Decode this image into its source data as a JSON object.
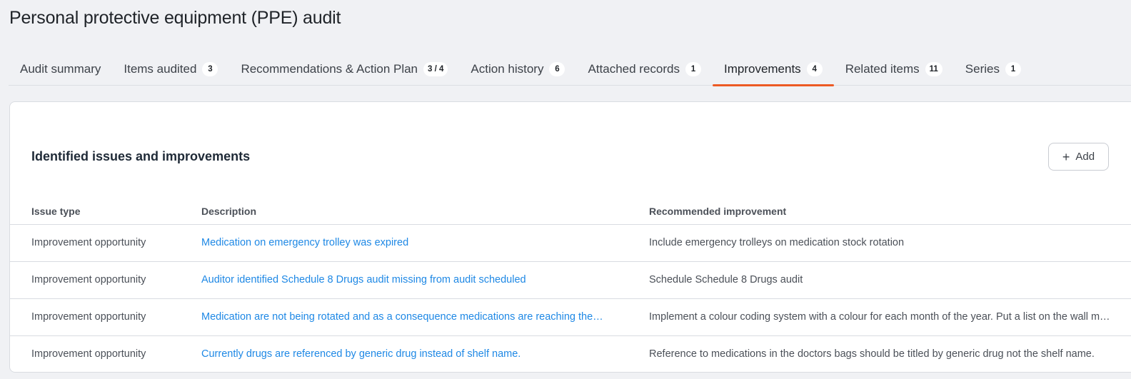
{
  "page": {
    "title": "Personal protective equipment (PPE) audit"
  },
  "tabs": [
    {
      "label": "Audit summary",
      "badge": ""
    },
    {
      "label": "Items audited",
      "badge": "3"
    },
    {
      "label": "Recommendations & Action Plan",
      "badge": "3 / 4"
    },
    {
      "label": "Action history",
      "badge": "6"
    },
    {
      "label": "Attached records",
      "badge": "1"
    },
    {
      "label": "Improvements",
      "badge": "4",
      "active": true
    },
    {
      "label": "Related items",
      "badge": "11"
    },
    {
      "label": "Series",
      "badge": "1"
    }
  ],
  "card": {
    "title": "Identified issues and improvements",
    "add_label": "Add"
  },
  "table": {
    "headers": [
      "Issue type",
      "Description",
      "Recommended improvement"
    ],
    "rows": [
      [
        "Improvement opportunity",
        "Medication on emergency trolley was expired",
        "Include emergency trolleys on medication stock rotation"
      ],
      [
        "Improvement opportunity",
        "Auditor identified Schedule 8 Drugs audit missing from audit scheduled",
        "Schedule Schedule 8 Drugs audit"
      ],
      [
        "Improvement opportunity",
        "Medication are not being rotated and as a consequence medications are reaching the…",
        "Implement a colour coding system with a colour for each month of the year. Put a list on the wall m…"
      ],
      [
        "Improvement opportunity",
        "Currently drugs are referenced by generic drug instead of shelf name.",
        "Reference to medications in the doctors bags should be titled by generic drug not the shelf name."
      ]
    ]
  },
  "colors": {
    "accent": "#ec5a24",
    "link": "#1e88e5"
  }
}
